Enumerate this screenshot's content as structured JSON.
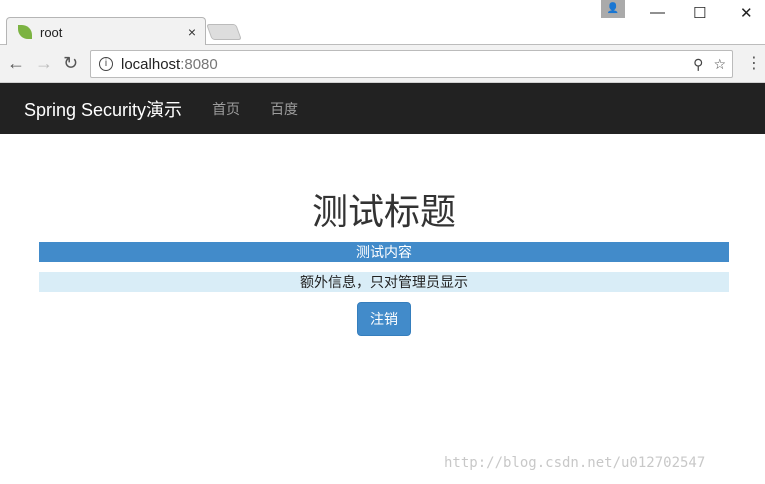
{
  "browser": {
    "tab_title": "root",
    "tab_close": "×",
    "url_host": "localhost",
    "url_port": ":8080",
    "profile_icon": "👤",
    "minimize": "—",
    "maximize": "☐",
    "close": "✕",
    "back": "←",
    "forward": "→",
    "reload": "↻",
    "info": "i",
    "key": "⚲",
    "star": "☆",
    "menu": "⋮"
  },
  "navbar": {
    "brand": "Spring Security演示",
    "links": [
      "首页",
      "百度"
    ]
  },
  "main": {
    "title": "测试标题",
    "content": "测试内容",
    "admin_info": "额外信息，只对管理员显示",
    "logout": "注销"
  },
  "watermark": "http://blog.csdn.net/u012702547"
}
